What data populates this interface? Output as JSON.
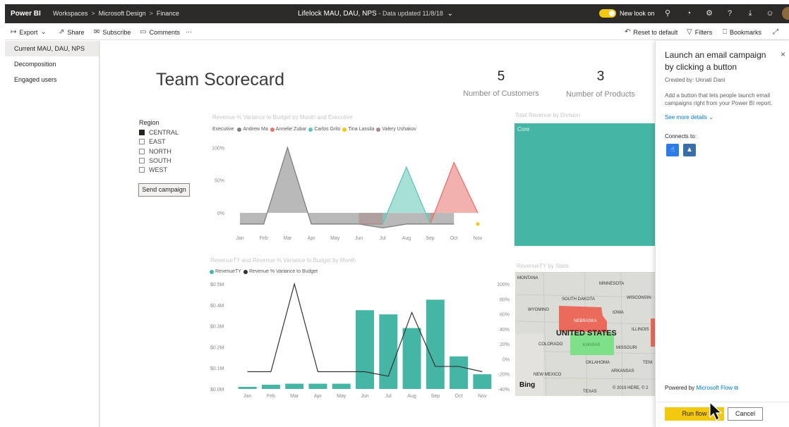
{
  "topbar": {
    "brand": "Power BI",
    "breadcrumb": [
      "Workspaces",
      "Microsoft Design",
      "Finance"
    ],
    "report_title": "Lifelock MAU, DAU, NPS",
    "report_subtitle": "- Data updated 11/8/18",
    "new_look_label": "New look on",
    "new_look_on": true,
    "icons": [
      "search-icon",
      "bell-icon",
      "gear-icon",
      "help-icon",
      "download-icon",
      "smiley-icon"
    ]
  },
  "actions": {
    "export": "Export",
    "share": "Share",
    "subscribe": "Subscribe",
    "comments": "Comments",
    "more": "···",
    "reset": "Reset to default",
    "filters": "Filters",
    "bookmarks": "Bookmarks"
  },
  "pages": [
    {
      "label": "Current MAU, DAU, NPS",
      "active": true
    },
    {
      "label": "Decomposition",
      "active": false
    },
    {
      "label": "Engaged users",
      "active": false
    }
  ],
  "report": {
    "scorecard_title": "Team Scorecard",
    "kpis": [
      {
        "value": "5",
        "label": "Number of Customers"
      },
      {
        "value": "3",
        "label": "Number of Products"
      }
    ],
    "slicer": {
      "title": "Region",
      "items": [
        {
          "label": "CENTRAL",
          "checked": true
        },
        {
          "label": "EAST",
          "checked": false
        },
        {
          "label": "NORTH",
          "checked": false
        },
        {
          "label": "SOUTH",
          "checked": false
        },
        {
          "label": "WEST",
          "checked": false
        }
      ]
    },
    "send_campaign": "Send campaign",
    "treemap": {
      "title": "Total Revenue by Division",
      "label": "Core",
      "color": "#45b5a6"
    },
    "map": {
      "title": "RevenueTY by State",
      "labels": [
        "MONTANA",
        "MINNESOTA",
        "SOUTH DAKOTA",
        "WISCONSIN",
        "WYOMING",
        "IOWA",
        "NEBRASKA",
        "UNITED STATES",
        "ILLINOIS",
        "COLORADO",
        "KANSAS",
        "MISSOURI",
        "OKLAHOMA",
        "ARKANSAS",
        "NEW MEXICO",
        "TEXAS",
        "TENI"
      ],
      "bing": "Bing",
      "copyright": "© 2019 HERE, © 2"
    }
  },
  "chart_data": [
    {
      "type": "area",
      "title": "Revenue % Variance to Budget by Month and Executive",
      "legend_title": "Executive",
      "categories": [
        "Jan",
        "Feb",
        "Mar",
        "Apr",
        "May",
        "Jun",
        "Jul",
        "Aug",
        "Sep",
        "Oct",
        "Nov"
      ],
      "y_ticks": [
        "100%",
        "50%",
        "0%"
      ],
      "ylim": [
        -0.3,
        1.1
      ],
      "series": [
        {
          "name": "Andrew Ma",
          "color": "#7f7f7f",
          "values": [
            -0.17,
            -0.17,
            1.0,
            -0.17,
            -0.17,
            -0.17,
            -0.23,
            -0.17,
            -0.17,
            -0.17,
            null
          ]
        },
        {
          "name": "Annelie Zubar",
          "color": "#e8716c",
          "values": [
            null,
            null,
            null,
            null,
            null,
            null,
            null,
            null,
            -0.17,
            0.77,
            0.0
          ]
        },
        {
          "name": "Carlos Grilo",
          "color": "#5fc6b7",
          "values": [
            null,
            null,
            null,
            null,
            null,
            null,
            -0.17,
            0.7,
            -0.17,
            null,
            null
          ]
        },
        {
          "name": "Tina Lassila",
          "color": "#f2c811",
          "values": [
            null,
            null,
            null,
            null,
            null,
            null,
            null,
            null,
            null,
            null,
            -0.17
          ]
        },
        {
          "name": "Valery Ushakov",
          "color": "#a78b8b",
          "values": [
            null,
            null,
            null,
            null,
            null,
            -0.17,
            -0.17,
            null,
            null,
            null,
            null
          ]
        }
      ]
    },
    {
      "type": "bar",
      "title": "RevenueTY and Revenue % Variance to Budget by Month",
      "categories": [
        "Jan",
        "Feb",
        "Mar",
        "Apr",
        "May",
        "Jun",
        "Jul",
        "Aug",
        "Sep",
        "Oct",
        "Nov"
      ],
      "y_ticks_left": [
        "$0.5M",
        "$0.4M",
        "$0.3M",
        "$0.2M",
        "$0.1M",
        "$0.0M"
      ],
      "y_ticks_right": [
        "100%",
        "80%",
        "60%",
        "40%",
        "20%",
        "0%",
        "-20%",
        "-40%"
      ],
      "ylim_left": [
        0,
        0.5
      ],
      "ylim_right": [
        -0.4,
        1.0
      ],
      "series": [
        {
          "name": "RevenueTY",
          "color": "#45b5a6",
          "values": [
            0.01,
            0.02,
            0.025,
            0.025,
            0.025,
            0.375,
            0.355,
            0.29,
            0.425,
            0.155,
            0.07
          ]
        },
        {
          "name": "Revenue % Variance to Budget",
          "color": "#333333",
          "values": [
            -0.17,
            -0.17,
            1.0,
            -0.17,
            -0.17,
            -0.17,
            -0.23,
            0.62,
            -0.1,
            -0.1,
            -0.17
          ]
        }
      ]
    }
  ],
  "pane": {
    "title": "Launch an email campaign by clicking a button",
    "created_by": "Created by: Unnati Dani",
    "description": "Add a button that lets people launch email campaigns right from your Power BI report.",
    "see_more": "See more details",
    "connects_to": "Connects to:",
    "connectors": [
      {
        "icon": "button-trigger-icon",
        "color": "#2d7be5"
      },
      {
        "icon": "powerbi-connector-icon",
        "color": "#3a6ea8"
      }
    ],
    "powered_by": "Powered by",
    "powered_link": "Microsoft Flow",
    "run_flow": "Run flow",
    "cancel": "Cancel",
    "close": "×"
  }
}
